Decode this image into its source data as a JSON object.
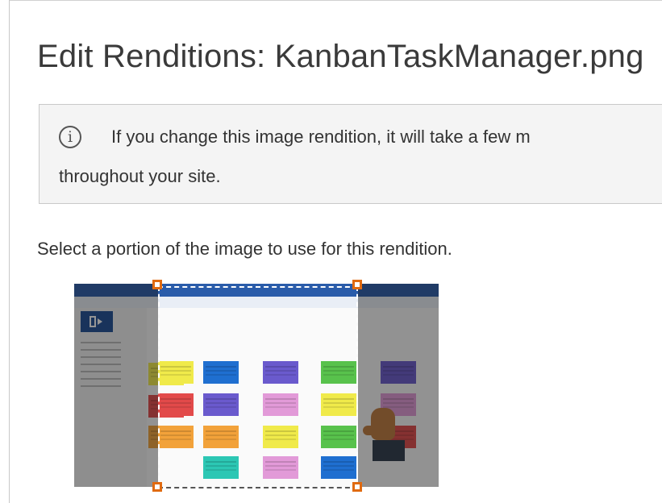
{
  "page": {
    "title": "Edit Renditions: KanbanTaskManager.png"
  },
  "notice": {
    "icon": "info-icon",
    "line1": "If you change this image rendition, it will take a few m",
    "line2": "throughout your site."
  },
  "instruction": "Select a portion of the image to use for this rendition.",
  "editor": {
    "icons": [
      "office-logo-icon",
      "hand-pointer-icon"
    ],
    "colors": {
      "handle": "#e06a10",
      "app_header": "#2a5caa",
      "sticky_yellow": "#f0ea4a",
      "sticky_blue": "#1f6fd0",
      "sticky_purple": "#6a5acd",
      "sticky_green": "#58c24c",
      "sticky_red": "#e24a4a",
      "sticky_orange": "#f2a23a",
      "sticky_pink": "#e29ad8",
      "sticky_teal": "#2cc7b4"
    }
  }
}
